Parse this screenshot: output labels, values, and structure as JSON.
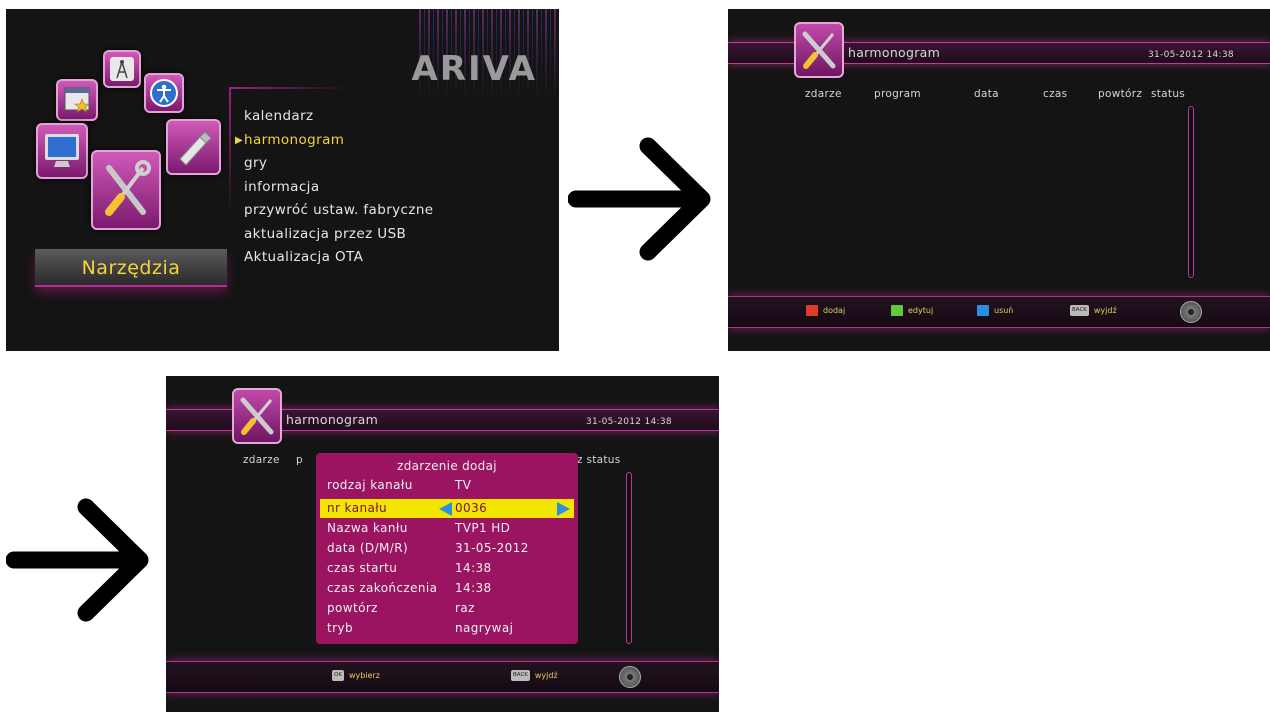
{
  "screen1": {
    "logo": "ARIVA",
    "menu": [
      {
        "label": "kalendarz",
        "selected": false
      },
      {
        "label": "harmonogram",
        "selected": true
      },
      {
        "label": "gry",
        "selected": false
      },
      {
        "label": "informacja",
        "selected": false
      },
      {
        "label": "przywróć ustaw. fabryczne",
        "selected": false
      },
      {
        "label": "aktualizacja przez USB",
        "selected": false
      },
      {
        "label": "Aktualizacja OTA",
        "selected": false
      }
    ],
    "section_title": "Narzędzia",
    "icons": [
      "calendar-star-icon",
      "antenna-icon",
      "accessibility-icon",
      "monitor-icon",
      "tools-icon",
      "usb-stick-icon"
    ]
  },
  "screen2": {
    "title": "harmonogram",
    "datetime": "31-05-2012 14:38",
    "columns": [
      "zdarze",
      "program",
      "data",
      "czas",
      "powtórz",
      "status"
    ],
    "footer": [
      {
        "label": "dodaj",
        "color": "#e03a2a",
        "icon": "red-key-icon"
      },
      {
        "label": "edytuj",
        "color": "#63c83a",
        "icon": "green-key-icon"
      },
      {
        "label": "usuń",
        "color": "#2a8fe0",
        "icon": "blue-key-icon"
      },
      {
        "label": "wyjdź",
        "key": "BACK",
        "icon": "back-key-icon"
      }
    ]
  },
  "screen3": {
    "title": "harmonogram",
    "datetime": "31-05-2012 14:38",
    "columns_visible": {
      "left": "zdarze",
      "left2": "p",
      "right": "z status"
    },
    "dialog": {
      "title": "zdarzenie dodaj",
      "rows": [
        {
          "label": "rodzaj kanału",
          "value": "TV"
        },
        {
          "label": "nr kanału",
          "value": "0036",
          "selected": true
        },
        {
          "label": "Nazwa kanłu",
          "value": "TVP1 HD"
        },
        {
          "label": "data (D/M/R)",
          "value": "31-05-2012"
        },
        {
          "label": "czas startu",
          "value": "14:38"
        },
        {
          "label": "czas zakończenia",
          "value": "14:38"
        },
        {
          "label": "powtórz",
          "value": "raz"
        },
        {
          "label": "tryb",
          "value": "nagrywaj"
        }
      ]
    },
    "footer": [
      {
        "label": "wybierz",
        "key": "OK",
        "icon": "ok-key-icon"
      },
      {
        "label": "wyjdź",
        "key": "BACK",
        "icon": "back-key-icon"
      }
    ]
  },
  "colors": {
    "accent": "#b82a98",
    "highlight": "#f2e600",
    "dialog": "#9b1461",
    "selected_text": "#f4d43a"
  }
}
